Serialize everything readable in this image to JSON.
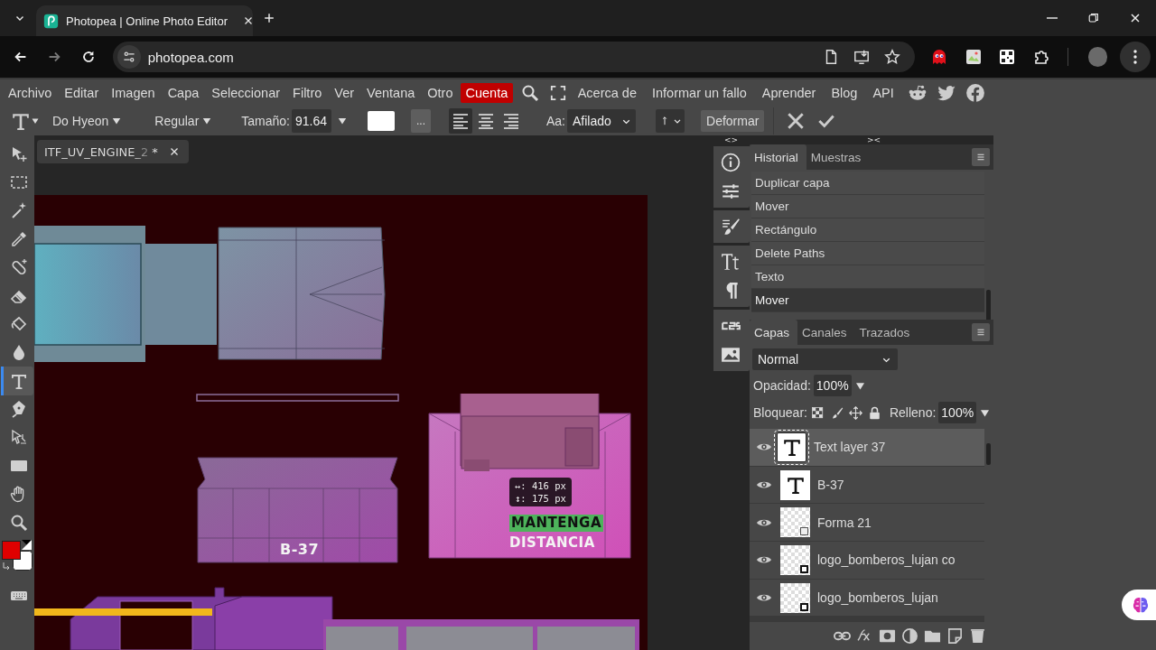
{
  "browser": {
    "tabs": [
      {
        "title": "Photopea | Online Photo Editor"
      }
    ],
    "url": "photopea.com"
  },
  "menu": {
    "items": [
      {
        "label": "Archivo",
        "highlighted": false
      },
      {
        "label": "Editar",
        "highlighted": false
      },
      {
        "label": "Imagen",
        "highlighted": false
      },
      {
        "label": "Capa",
        "highlighted": false
      },
      {
        "label": "Seleccionar",
        "highlighted": false
      },
      {
        "label": "Filtro",
        "highlighted": false
      },
      {
        "label": "Ver",
        "highlighted": false
      },
      {
        "label": "Ventana",
        "highlighted": false
      },
      {
        "label": "Otro",
        "highlighted": false
      },
      {
        "label": "Cuenta",
        "highlighted": true
      }
    ],
    "links": [
      "Acerca de",
      "Informar un fallo",
      "Aprender",
      "Blog",
      "API"
    ]
  },
  "toolbar": {
    "font": "Do Hyeon",
    "style": "Regular",
    "size_label": "Tamaño:",
    "size": "91.64",
    "more": "...",
    "alignments": [
      {
        "kind": "left",
        "selected": true
      },
      {
        "kind": "center",
        "selected": false
      },
      {
        "kind": "right",
        "selected": false
      }
    ],
    "aa_label": "Aa:",
    "antialias": "Afilado",
    "warp": "Deformar"
  },
  "tools": [
    {
      "kind": "move",
      "selected": false
    },
    {
      "kind": "marquee",
      "selected": false
    },
    {
      "kind": "wand",
      "selected": false
    },
    {
      "kind": "eyedropper",
      "selected": false
    },
    {
      "kind": "heal",
      "selected": false
    },
    {
      "kind": "eraser",
      "selected": false
    },
    {
      "kind": "bucket",
      "selected": false
    },
    {
      "kind": "blur",
      "selected": false
    },
    {
      "kind": "type",
      "selected": true
    },
    {
      "kind": "pen",
      "selected": false
    },
    {
      "kind": "select",
      "selected": false
    },
    {
      "kind": "rectangle",
      "selected": false
    },
    {
      "kind": "hand",
      "selected": false
    },
    {
      "kind": "zoom",
      "selected": false
    }
  ],
  "document": {
    "tabs": [
      {
        "title": "ITF_UV_ENGINE_2",
        "mark": "*"
      }
    ]
  },
  "canvas": {
    "labels": [
      {
        "text": "B-37",
        "kind": "plain"
      },
      {
        "text": "MANTENGA",
        "kind": "highlight"
      },
      {
        "text": "DISTANCIA",
        "kind": "plain"
      }
    ],
    "measure": {
      "width": "↔: 416 px",
      "height": "↕: 175 px"
    }
  },
  "panel_toggles": [
    "<>",
    "><"
  ],
  "history": {
    "tabs": [
      {
        "label": "Historial",
        "selected": true
      },
      {
        "label": "Muestras",
        "selected": false
      }
    ],
    "items": [
      {
        "label": "Duplicar capa",
        "selected": false
      },
      {
        "label": "Mover",
        "selected": false
      },
      {
        "label": "Rectángulo",
        "selected": false
      },
      {
        "label": "Delete Paths",
        "selected": false
      },
      {
        "label": "Texto",
        "selected": false
      },
      {
        "label": "Mover",
        "selected": true
      }
    ]
  },
  "layers": {
    "tabs": [
      {
        "label": "Capas",
        "selected": true
      },
      {
        "label": "Canales",
        "selected": false
      },
      {
        "label": "Trazados",
        "selected": false
      }
    ],
    "blend_mode": "Normal",
    "opacity_label": "Opacidad:",
    "opacity": "100%",
    "lock_label": "Bloquear:",
    "fill_label": "Relleno:",
    "fill": "100%",
    "items": [
      {
        "name": "Text layer 37",
        "kind": "text",
        "selected": true,
        "visible": true
      },
      {
        "name": "B-37",
        "kind": "text",
        "selected": false,
        "visible": true
      },
      {
        "name": "Forma 21",
        "kind": "shape",
        "selected": false,
        "visible": true
      },
      {
        "name": "logo_bomberos_lujan co",
        "kind": "smart",
        "selected": false,
        "visible": true
      },
      {
        "name": "logo_bomberos_lujan",
        "kind": "smart",
        "selected": false,
        "visible": true
      }
    ]
  }
}
